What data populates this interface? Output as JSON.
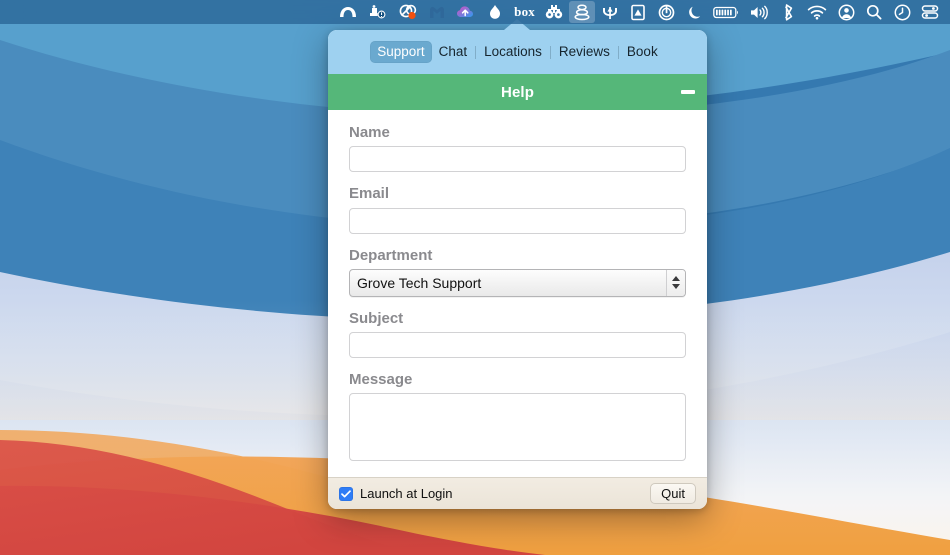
{
  "menubar": {
    "items": [
      {
        "name": "backblaze-icon",
        "glyph": "arc"
      },
      {
        "name": "carbon-copy-cloner-icon",
        "glyph": "ccc"
      },
      {
        "name": "cleanmymac-icon",
        "glyph": "rings"
      },
      {
        "name": "mullvad-icon",
        "glyph": "mullvad"
      },
      {
        "name": "cloud-upload-icon",
        "glyph": "cloudup"
      },
      {
        "name": "flame-icon",
        "glyph": "flame"
      },
      {
        "name": "box-icon",
        "glyph": "text",
        "text": "box"
      },
      {
        "name": "binoculars-icon",
        "glyph": "binoculars"
      },
      {
        "name": "pancake-stack-icon",
        "glyph": "stack",
        "active": true
      },
      {
        "name": "trident-icon",
        "glyph": "trident"
      },
      {
        "name": "aperture-document-icon",
        "glyph": "doc"
      },
      {
        "name": "power-icon",
        "glyph": "power"
      },
      {
        "name": "moon-icon",
        "glyph": "moon"
      },
      {
        "name": "battery-icon",
        "glyph": "battery"
      },
      {
        "name": "volume-icon",
        "glyph": "volume"
      },
      {
        "name": "bluetooth-icon",
        "glyph": "bluetooth"
      },
      {
        "name": "wifi-icon",
        "glyph": "wifi"
      },
      {
        "name": "user-account-icon",
        "glyph": "user"
      },
      {
        "name": "spotlight-search-icon",
        "glyph": "search"
      },
      {
        "name": "time-machine-icon",
        "glyph": "clock"
      },
      {
        "name": "control-center-icon",
        "glyph": "control"
      }
    ]
  },
  "popover": {
    "tabs": [
      {
        "label": "Support",
        "selected": true
      },
      {
        "label": "Chat",
        "selected": false
      },
      {
        "label": "Locations",
        "selected": false
      },
      {
        "label": "Reviews",
        "selected": false
      },
      {
        "label": "Book",
        "selected": false
      }
    ],
    "header": {
      "title": "Help",
      "minimize_label": "Minimize"
    },
    "form": {
      "name": {
        "label": "Name",
        "value": "",
        "placeholder": ""
      },
      "email": {
        "label": "Email",
        "value": "",
        "placeholder": ""
      },
      "department": {
        "label": "Department",
        "value": "Grove Tech Support",
        "options": [
          "Grove Tech Support"
        ]
      },
      "subject": {
        "label": "Subject",
        "value": "",
        "placeholder": ""
      },
      "message": {
        "label": "Message",
        "value": "",
        "placeholder": ""
      }
    },
    "footer": {
      "launch_at_login_label": "Launch at Login",
      "launch_at_login_checked": true,
      "quit_label": "Quit"
    }
  },
  "colors": {
    "tabbar_bg": "#9ed1f0",
    "tab_selected_bg": "#6aa9cf",
    "header_green": "#55b779",
    "footer_bg": "#efe9de",
    "checkbox_blue": "#2f7cf6",
    "label_gray": "#8a8a8e"
  }
}
